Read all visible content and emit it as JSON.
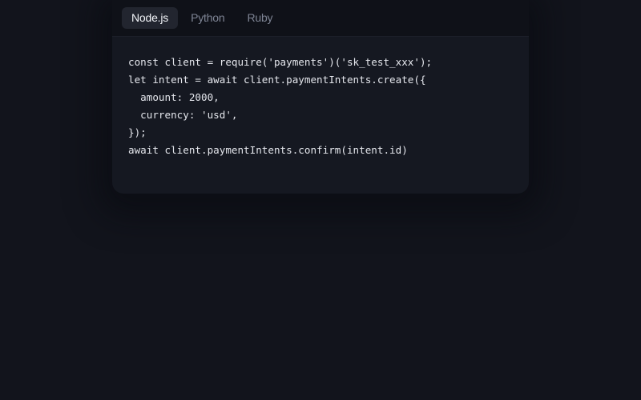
{
  "tabs": [
    {
      "label": "Node.js",
      "active": true
    },
    {
      "label": "Python",
      "active": false
    },
    {
      "label": "Ruby",
      "active": false
    }
  ],
  "code": {
    "lines": [
      "const client = require('payments')('sk_test_xxx');",
      "let intent = await client.paymentIntents.create({",
      "  amount: 2000,",
      "  currency: 'usd',",
      "});",
      "await client.paymentIntents.confirm(intent.id)"
    ]
  },
  "colors": {
    "background": "#12141c",
    "card": "#151821",
    "tab_bar": "#0f1118",
    "active_tab": "#22252f",
    "code_text": "#e4e6ec",
    "inactive_tab_text": "#7e8494"
  }
}
